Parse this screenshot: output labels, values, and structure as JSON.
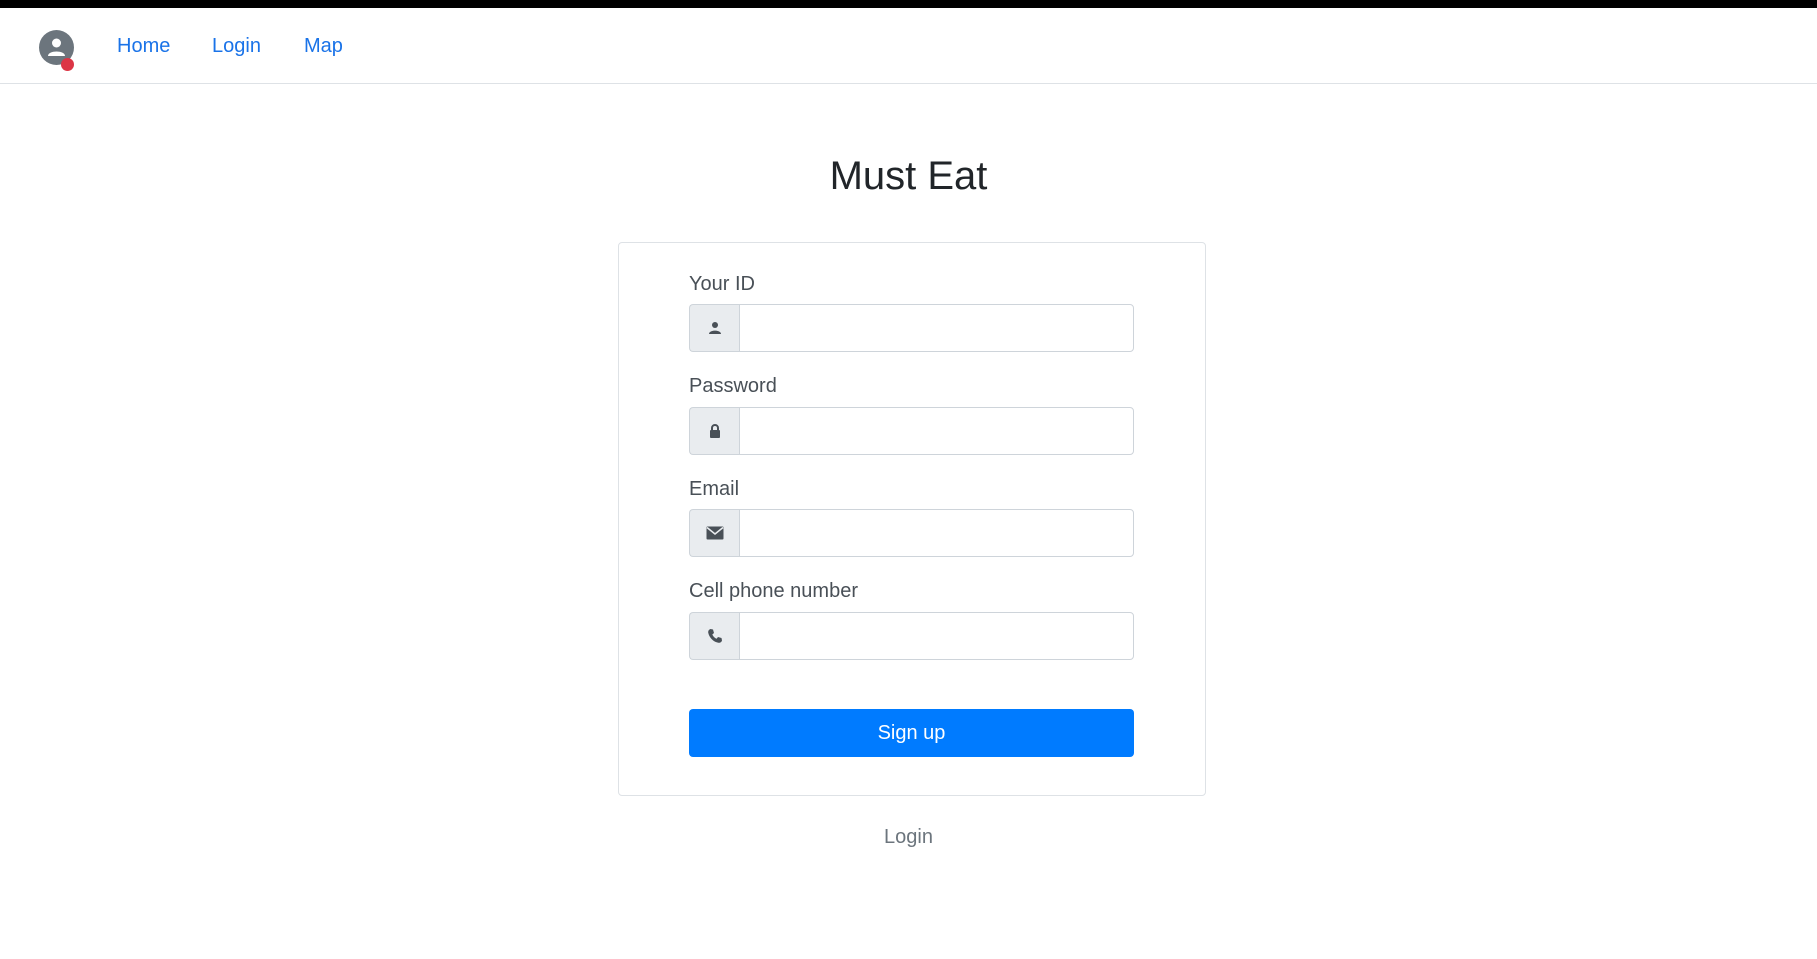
{
  "nav": {
    "avatar_icon": "user-circle-icon",
    "links": [
      {
        "label": "Home"
      },
      {
        "label": "Login"
      },
      {
        "label": "Map"
      }
    ]
  },
  "page": {
    "title": "Must Eat"
  },
  "form": {
    "fields": [
      {
        "label": "Your ID",
        "icon": "person-icon",
        "value": "",
        "placeholder": ""
      },
      {
        "label": "Password",
        "icon": "lock-icon",
        "value": "",
        "placeholder": ""
      },
      {
        "label": "Email",
        "icon": "envelope-icon",
        "value": "",
        "placeholder": ""
      },
      {
        "label": "Cell phone number",
        "icon": "phone-icon",
        "value": "",
        "placeholder": ""
      }
    ],
    "submit_label": "Sign up"
  },
  "footer": {
    "login_link": "Login"
  },
  "colors": {
    "primary": "#007bff",
    "link": "#1a73e8",
    "badge": "#dc3545"
  }
}
